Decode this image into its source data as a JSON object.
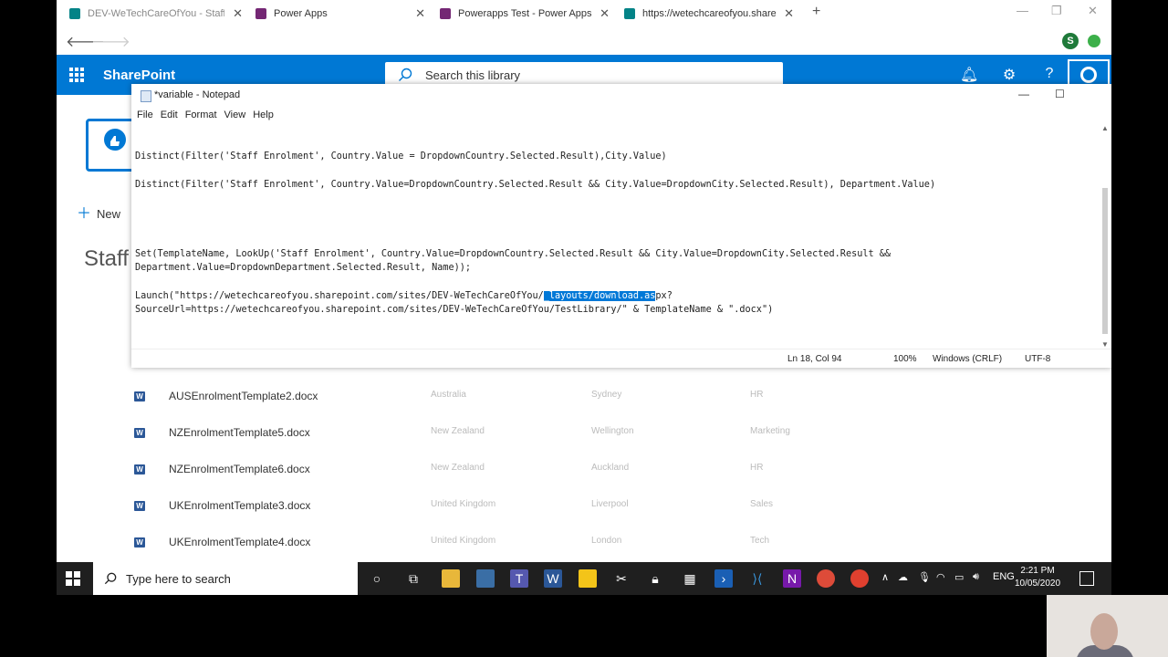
{
  "browser": {
    "tabs": [
      {
        "title": "DEV-WeTechCareOfYou - Staff E",
        "color": "#038387"
      },
      {
        "title": "Power Apps",
        "color": "#742774"
      },
      {
        "title": "Powerapps Test - Power Apps",
        "color": "#742774"
      },
      {
        "title": "https://wetechcareofyou.sharep",
        "color": "#038387"
      }
    ],
    "new_tab": "+",
    "profile_initial": "S"
  },
  "sharepoint": {
    "app_name": "SharePoint",
    "search_placeholder": "Search this library",
    "new_label": "New",
    "page_title_partial": "Staff"
  },
  "notepad": {
    "title": "*variable - Notepad",
    "menu": [
      "File",
      "Edit",
      "Format",
      "View",
      "Help"
    ],
    "lines": {
      "l1": "Distinct(Filter('Staff Enrolment', Country.Value = DropdownCountry.Selected.Result),City.Value)",
      "l2": "Distinct(Filter('Staff Enrolment', Country.Value=DropdownCountry.Selected.Result && City.Value=DropdownCity.Selected.Result), Department.Value)",
      "l3": "Set(TemplateName, LookUp('Staff Enrolment', Country.Value=DropdownCountry.Selected.Result && City.Value=DropdownCity.Selected.Result &&",
      "l4": "Department.Value=DropdownDepartment.Selected.Result, Name));",
      "l5a": "Launch(\"https://wetechcareofyou.sharepoint.com/sites/DEV-WeTechCareOfYou/",
      "l5sel": "_layouts/download.as",
      "l5b": "px?",
      "l6": "SourceUrl=https://wetechcareofyou.sharepoint.com/sites/DEV-WeTechCareOfYou/TestLibrary/\" & TemplateName & \".docx\")"
    },
    "status": {
      "position": "Ln 18, Col 94",
      "zoom": "100%",
      "line_endings": "Windows (CRLF)",
      "encoding": "UTF-8"
    }
  },
  "library_rows": [
    {
      "name": "AUSEnrolmentTemplate2.docx",
      "country": "Australia",
      "city": "Sydney",
      "department": "HR"
    },
    {
      "name": "NZEnrolmentTemplate5.docx",
      "country": "New Zealand",
      "city": "Wellington",
      "department": "Marketing"
    },
    {
      "name": "NZEnrolmentTemplate6.docx",
      "country": "New Zealand",
      "city": "Auckland",
      "department": "HR"
    },
    {
      "name": "UKEnrolmentTemplate3.docx",
      "country": "United Kingdom",
      "city": "Liverpool",
      "department": "Sales"
    },
    {
      "name": "UKEnrolmentTemplate4.docx",
      "country": "United Kingdom",
      "city": "London",
      "department": "Tech"
    }
  ],
  "taskbar": {
    "search_placeholder": "Type here to search",
    "language": "ENG",
    "time": "2:21 PM",
    "date": "10/05/2020"
  }
}
